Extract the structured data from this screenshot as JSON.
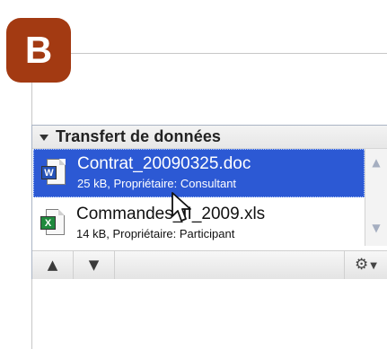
{
  "step_badge": "B",
  "panel": {
    "title": "Transfert de données",
    "files": [
      {
        "name": "Contrat_20090325.doc",
        "meta": "25 kB, Propriétaire: Consultant",
        "icon": "word-document-icon",
        "icon_text": "W",
        "selected": true
      },
      {
        "name": "Commandes_II_2009.xls",
        "meta": "14 kB, Propriétaire: Participant",
        "icon": "excel-document-icon",
        "icon_text": "X",
        "selected": false
      }
    ],
    "toolbar": {
      "up_icon": "▲",
      "down_icon": "▼",
      "settings_icon": "⚙",
      "menu_icon": "▼"
    },
    "scrollbar": {
      "up_icon": "▲",
      "down_icon": "▼"
    }
  },
  "colors": {
    "badge": "#a33a12",
    "selection": "#2c59d4",
    "border": "#aab4c4"
  }
}
